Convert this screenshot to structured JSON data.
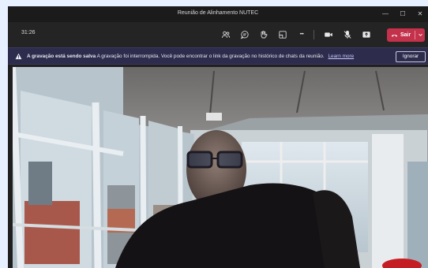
{
  "window": {
    "title": "Reunião de Alinhamento NUTEC",
    "minimize_glyph": "—",
    "maximize_glyph": "☐",
    "close_glyph": "✕"
  },
  "toolbar": {
    "timer": "31:26",
    "icons": [
      "people-icon",
      "chat-icon",
      "reactions-icon",
      "rooms-icon",
      "more-icon",
      "camera-icon",
      "mic-off-icon",
      "share-icon"
    ],
    "more_glyph": "•••",
    "leave_label": "Sair",
    "leave_color": "#c4314b"
  },
  "banner": {
    "bold_text": "A gravação está sendo salva",
    "text": "A gravação foi interrompida. Você pode encontrar o link da gravação no histórico de chats da reunião.",
    "link_text": "Learn more",
    "ignore_label": "Ignorar",
    "background": "#2d2c4c"
  }
}
